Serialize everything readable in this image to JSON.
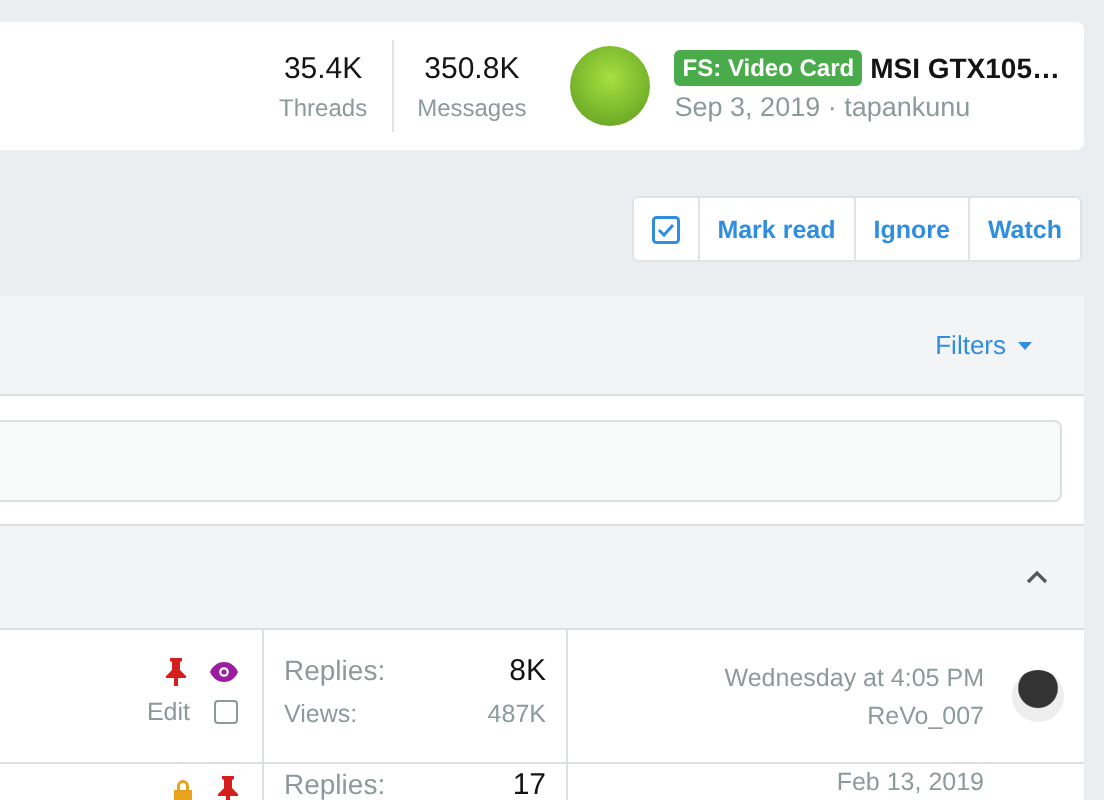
{
  "stats": [
    {
      "value": "35.4K",
      "label": "Threads"
    },
    {
      "value": "350.8K",
      "label": "Messages"
    }
  ],
  "latest": {
    "prefix": "FS: Video Card",
    "title": "MSI GTX105…",
    "meta": "Sep 3, 2019 · tapankunu"
  },
  "actions": {
    "select_all": {
      "checked": true
    },
    "buttons": [
      "Mark read",
      "Ignore",
      "Watch"
    ]
  },
  "filters": {
    "label": "Filters"
  },
  "section": {
    "expanded": true
  },
  "threads": [
    {
      "locked": false,
      "sticky": true,
      "watched": true,
      "edit": "Edit",
      "selected": false,
      "replies_label": "Replies:",
      "replies": "8K",
      "views_label": "Views:",
      "views": "487K",
      "last_date": "Wednesday at 4:05 PM",
      "last_user": "ReVo_007"
    },
    {
      "locked": true,
      "sticky": true,
      "watched": false,
      "replies_label": "Replies:",
      "replies": "17",
      "last_date": "Feb 13, 2019"
    }
  ]
}
